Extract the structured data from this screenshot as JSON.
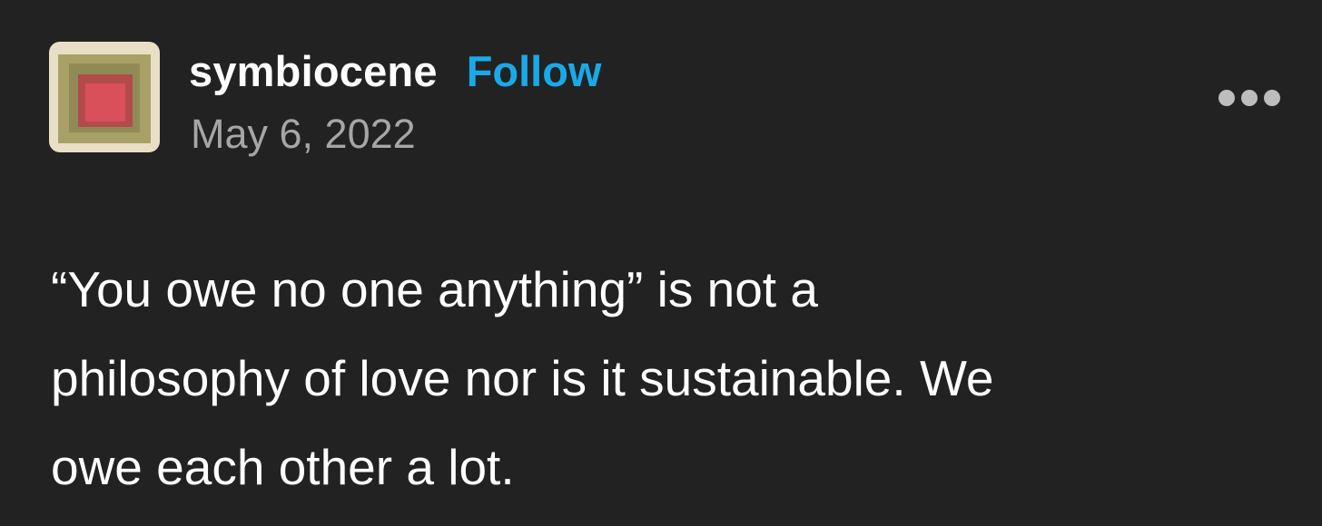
{
  "post": {
    "author": {
      "username": "symbiocene",
      "follow_label": "Follow",
      "date": "May 6, 2022",
      "avatar_icon": "color-squares-avatar"
    },
    "menu_icon": "more-options-icon",
    "body_lines": [
      "“You owe no one anything” is not a",
      "philosophy of love nor is it sustainable. We",
      "owe each other a lot."
    ]
  },
  "colors": {
    "background": "#222222",
    "text": "#ffffff",
    "follow": "#1aa9e8",
    "date": "#a6a6a6"
  }
}
